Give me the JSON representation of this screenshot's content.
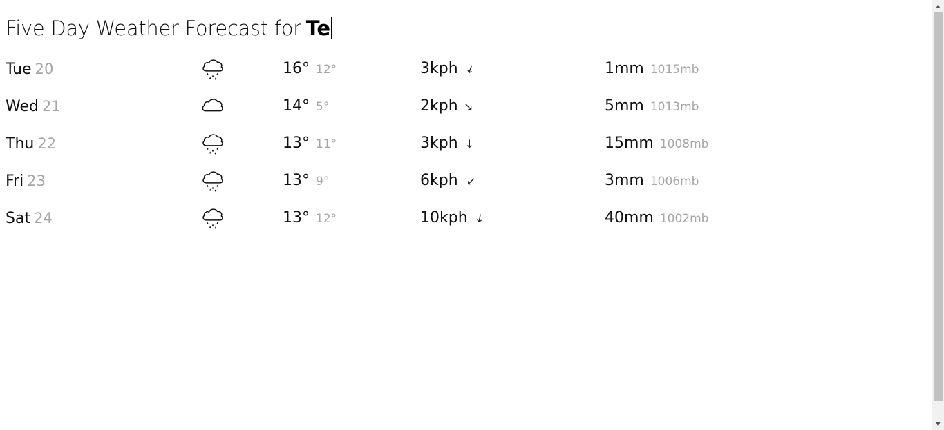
{
  "header": {
    "title_prefix": "Five Day Weather Forecast for",
    "city_input_value": "Te"
  },
  "forecast": [
    {
      "day": "Tue",
      "date": "20",
      "icon": "rain-cloud-icon",
      "high": "16°",
      "low": "12°",
      "wind": "3kph",
      "wind_dir_deg": 20,
      "rain": "1mm",
      "pressure": "1015mb"
    },
    {
      "day": "Wed",
      "date": "21",
      "icon": "cloud-icon",
      "high": "14°",
      "low": "5°",
      "wind": "2kph",
      "wind_dir_deg": -45,
      "rain": "5mm",
      "pressure": "1013mb"
    },
    {
      "day": "Thu",
      "date": "22",
      "icon": "rain-cloud-icon",
      "high": "13°",
      "low": "11°",
      "wind": "3kph",
      "wind_dir_deg": 0,
      "rain": "15mm",
      "pressure": "1008mb"
    },
    {
      "day": "Fri",
      "date": "23",
      "icon": "rain-cloud-icon",
      "high": "13°",
      "low": "9°",
      "wind": "6kph",
      "wind_dir_deg": 45,
      "rain": "3mm",
      "pressure": "1006mb"
    },
    {
      "day": "Sat",
      "date": "24",
      "icon": "rain-cloud-icon",
      "high": "13°",
      "low": "12°",
      "wind": "10kph",
      "wind_dir_deg": 10,
      "rain": "40mm",
      "pressure": "1002mb"
    }
  ],
  "scrollbar": {
    "up_icon": "▲",
    "down_icon": "▼"
  }
}
